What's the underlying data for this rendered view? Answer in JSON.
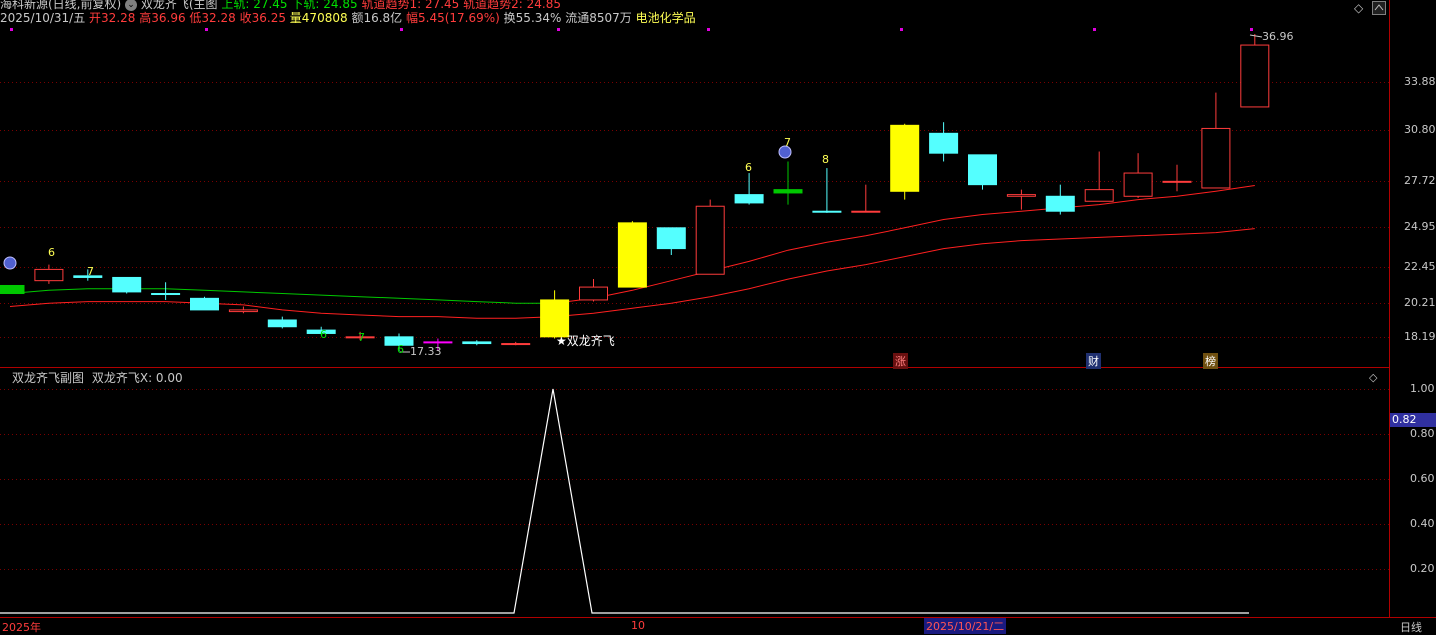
{
  "header_row1": {
    "stock": "海科新源(日线,前复权)",
    "indicator": "双龙齐飞(主图",
    "upper_label": "上轨: 27.45",
    "lower_label": "下轨: 24.85",
    "trend1": "轨道趋势1: 27.45",
    "trend2": "轨道趋势2: 24.85"
  },
  "header_row2": {
    "date": "2025/10/31/五",
    "open": "开32.28",
    "high": "高36.96",
    "low": "低32.28",
    "close": "收36.25",
    "volume": "量470808",
    "amount": "额16.8亿",
    "change": "幅5.45(17.69%)",
    "turnover": "换55.34%",
    "float": "流通8507万",
    "sector": "电池化学品"
  },
  "sub_header": {
    "name": "双龙齐飞副图",
    "value_label": "双龙齐飞X: 0.00"
  },
  "price_axis": [
    "33.88",
    "30.80",
    "27.72",
    "24.95",
    "22.45",
    "20.21",
    "18.19"
  ],
  "sub_axis": [
    "1.00",
    "0.80",
    "0.60",
    "0.40",
    "0.20"
  ],
  "sub_current": "0.82",
  "x_labels": {
    "year": "2025年",
    "month": "10",
    "date": "2025/10/21/二"
  },
  "period": "日线",
  "annotations": {
    "high_mark": "36.96",
    "low_mark": "17.33",
    "signal": "★双龙齐飞",
    "nums": [
      "6",
      "7",
      "6",
      "7",
      "6",
      "7",
      "8",
      "6"
    ],
    "tags": [
      "涨",
      "财",
      "榜"
    ]
  },
  "colors": {
    "up": "#ff3c3c",
    "down": "#54ffff",
    "signal": "#ffff00",
    "green": "#00c800",
    "magenta": "#ff00ff"
  },
  "chart_data": {
    "type": "candlestick",
    "candles": [
      {
        "o": 20.8,
        "h": 21.3,
        "l": 20.8,
        "c": 21.3,
        "k": "green"
      },
      {
        "o": 21.6,
        "h": 22.6,
        "l": 21.4,
        "c": 22.3,
        "k": "up"
      },
      {
        "o": 21.9,
        "h": 22.3,
        "l": 21.6,
        "c": 21.8,
        "k": "down"
      },
      {
        "o": 21.8,
        "h": 21.8,
        "l": 20.8,
        "c": 20.9,
        "k": "down"
      },
      {
        "o": 20.8,
        "h": 21.5,
        "l": 20.4,
        "c": 20.8,
        "k": "down"
      },
      {
        "o": 20.5,
        "h": 20.6,
        "l": 19.8,
        "c": 19.8,
        "k": "down"
      },
      {
        "o": 19.8,
        "h": 20.0,
        "l": 19.6,
        "c": 19.7,
        "k": "up"
      },
      {
        "o": 19.2,
        "h": 19.4,
        "l": 18.7,
        "c": 18.8,
        "k": "down"
      },
      {
        "o": 18.6,
        "h": 18.8,
        "l": 18.4,
        "c": 18.4,
        "k": "down"
      },
      {
        "o": 18.2,
        "h": 18.5,
        "l": 18.0,
        "c": 18.2,
        "k": "up"
      },
      {
        "o": 18.2,
        "h": 18.4,
        "l": 17.33,
        "c": 17.7,
        "k": "down"
      },
      {
        "o": 17.9,
        "h": 18.1,
        "l": 17.4,
        "c": 17.9,
        "k": "magenta"
      },
      {
        "o": 17.9,
        "h": 18.0,
        "l": 17.7,
        "c": 17.8,
        "k": "down"
      },
      {
        "o": 17.8,
        "h": 17.9,
        "l": 17.7,
        "c": 17.8,
        "k": "up"
      },
      {
        "o": 18.2,
        "h": 21.0,
        "l": 18.1,
        "c": 20.4,
        "k": "yellow"
      },
      {
        "o": 20.4,
        "h": 21.7,
        "l": 20.3,
        "c": 21.2,
        "k": "up"
      },
      {
        "o": 21.2,
        "h": 25.3,
        "l": 21.2,
        "c": 25.2,
        "k": "yellow"
      },
      {
        "o": 24.9,
        "h": 24.9,
        "l": 23.2,
        "c": 23.6,
        "k": "down"
      },
      {
        "o": 22.0,
        "h": 26.6,
        "l": 22.0,
        "c": 26.2,
        "k": "up"
      },
      {
        "o": 26.9,
        "h": 28.2,
        "l": 26.3,
        "c": 26.4,
        "k": "down"
      },
      {
        "o": 27.2,
        "h": 28.9,
        "l": 26.3,
        "c": 27.0,
        "k": "green"
      },
      {
        "o": 25.9,
        "h": 28.5,
        "l": 25.8,
        "c": 25.9,
        "k": "down"
      },
      {
        "o": 25.9,
        "h": 27.5,
        "l": 25.9,
        "c": 25.9,
        "k": "up"
      },
      {
        "o": 27.1,
        "h": 31.2,
        "l": 26.6,
        "c": 31.1,
        "k": "yellow"
      },
      {
        "o": 30.6,
        "h": 31.3,
        "l": 28.9,
        "c": 29.4,
        "k": "down"
      },
      {
        "o": 29.3,
        "h": 29.3,
        "l": 27.2,
        "c": 27.5,
        "k": "down"
      },
      {
        "o": 26.8,
        "h": 27.2,
        "l": 26.0,
        "c": 26.9,
        "k": "up"
      },
      {
        "o": 26.8,
        "h": 27.5,
        "l": 25.7,
        "c": 25.9,
        "k": "down"
      },
      {
        "o": 26.5,
        "h": 29.5,
        "l": 26.5,
        "c": 27.2,
        "k": "up"
      },
      {
        "o": 26.8,
        "h": 29.4,
        "l": 26.7,
        "c": 28.2,
        "k": "up"
      },
      {
        "o": 27.7,
        "h": 28.7,
        "l": 27.1,
        "c": 27.7,
        "k": "up"
      },
      {
        "o": 27.3,
        "h": 33.2,
        "l": 27.3,
        "c": 30.9,
        "k": "up"
      },
      {
        "o": 32.28,
        "h": 36.96,
        "l": 32.28,
        "c": 36.25,
        "k": "up"
      }
    ],
    "upper_band": [
      20.8,
      21.0,
      21.1,
      21.1,
      21.1,
      21.0,
      20.9,
      20.8,
      20.7,
      20.6,
      20.5,
      20.4,
      20.3,
      20.2,
      20.2,
      20.5,
      21.0,
      21.6,
      22.2,
      22.8,
      23.5,
      24.0,
      24.4,
      24.9,
      25.4,
      25.7,
      25.9,
      26.1,
      26.3,
      26.6,
      26.8,
      27.1,
      27.45
    ],
    "lower_band": [
      20.0,
      20.2,
      20.3,
      20.3,
      20.3,
      20.2,
      20.1,
      19.8,
      19.6,
      19.5,
      19.4,
      19.4,
      19.3,
      19.3,
      19.4,
      19.6,
      19.9,
      20.2,
      20.6,
      21.1,
      21.7,
      22.2,
      22.6,
      23.1,
      23.6,
      23.9,
      24.1,
      24.2,
      24.3,
      24.4,
      24.5,
      24.6,
      24.85
    ],
    "sub_series": [
      0,
      0,
      0,
      0,
      0,
      0,
      0,
      0,
      0,
      0,
      0,
      0,
      0,
      1,
      0,
      0,
      0,
      0,
      0,
      0,
      0,
      0,
      0,
      0,
      0,
      0,
      0,
      0,
      0,
      0,
      0
    ],
    "xlabel": "",
    "ylabel": ""
  }
}
